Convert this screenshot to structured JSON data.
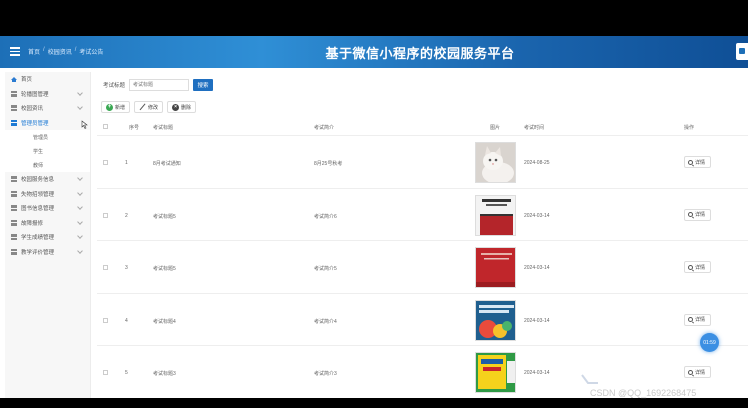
{
  "header": {
    "breadcrumb": [
      "首页",
      "校园资讯",
      "考试公告"
    ],
    "title": "基于微信小程序的校园服务平台"
  },
  "sidebar": {
    "home": "首页",
    "items": [
      {
        "label": "轮播图管理"
      },
      {
        "label": "校园资讯"
      },
      {
        "label": "管理员管理",
        "active": true,
        "children": [
          "管理员",
          "学生",
          "教师"
        ]
      },
      {
        "label": "校园服务信息"
      },
      {
        "label": "失物招领管理"
      },
      {
        "label": "图书信息管理"
      },
      {
        "label": "故障报修"
      },
      {
        "label": "学生成绩管理"
      },
      {
        "label": "教学评价管理"
      }
    ]
  },
  "search": {
    "label": "考试标题",
    "placeholder": "考试标题",
    "button": "搜索"
  },
  "actions": {
    "add": "新增",
    "edit": "修改",
    "delete": "删除"
  },
  "table": {
    "headers": [
      "序号",
      "考试标题",
      "考试简介",
      "图片",
      "考试时间",
      "操作"
    ],
    "rows": [
      {
        "index": "1",
        "title": "8月考试通知",
        "intro": "8月25号秋考",
        "date": "2024-08-25",
        "action": "详情",
        "image": "cat"
      },
      {
        "index": "2",
        "title": "考试标题5",
        "intro": "考试简介6",
        "date": "2024-03-14",
        "action": "详情",
        "image": "book-white"
      },
      {
        "index": "3",
        "title": "考试标题5",
        "intro": "考试简介5",
        "date": "2024-03-14",
        "action": "详情",
        "image": "book-red"
      },
      {
        "index": "4",
        "title": "考试标题4",
        "intro": "考试简介4",
        "date": "2024-03-14",
        "action": "详情",
        "image": "book-blue"
      },
      {
        "index": "5",
        "title": "考试标题3",
        "intro": "考试简介3",
        "date": "2024-03-14",
        "action": "详情",
        "image": "book-yellow"
      }
    ]
  },
  "overlay": {
    "badge": "01:59",
    "watermark": "CSDN @QQ_1692268475"
  }
}
